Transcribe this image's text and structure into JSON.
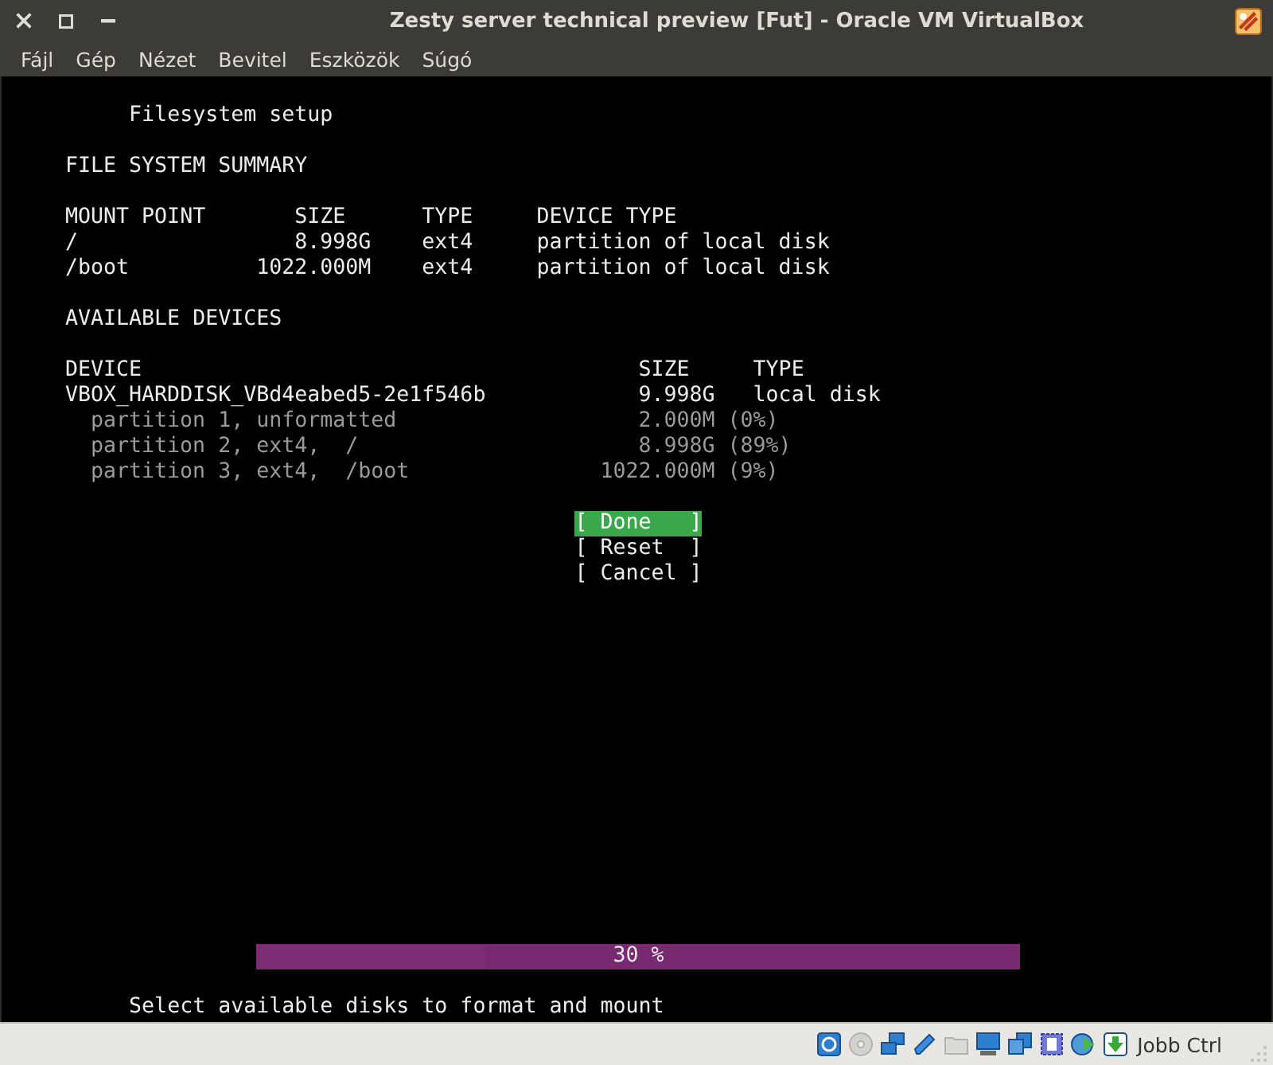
{
  "window": {
    "title": "Zesty server technical preview [Fut] - Oracle VM VirtualBox"
  },
  "menu": [
    "Fájl",
    "Gép",
    "Nézet",
    "Bevitel",
    "Eszközök",
    "Súgó"
  ],
  "screen": {
    "heading": "Filesystem setup",
    "summary": {
      "title": "FILE SYSTEM SUMMARY",
      "columns": [
        "MOUNT POINT",
        "SIZE",
        "TYPE",
        "DEVICE TYPE"
      ],
      "rows": [
        {
          "mount_point": "/",
          "size": "8.998G",
          "type": "ext4",
          "device_type": "partition of local disk"
        },
        {
          "mount_point": "/boot",
          "size": "1022.000M",
          "type": "ext4",
          "device_type": "partition of local disk"
        }
      ]
    },
    "devices": {
      "title": "AVAILABLE DEVICES",
      "columns": [
        "DEVICE",
        "SIZE",
        "TYPE"
      ],
      "rows": [
        {
          "kind": "disk",
          "device": "VBOX_HARDDISK_VBd4eabed5-2e1f546b",
          "size": "9.998G",
          "type": "local disk"
        },
        {
          "kind": "partition",
          "device": "partition 1, unformatted",
          "size": "2.000M",
          "share": "(0%)"
        },
        {
          "kind": "partition",
          "device": "partition 2, ext4,  /",
          "size": "8.998G",
          "share": "(89%)"
        },
        {
          "kind": "partition",
          "device": "partition 3, ext4,  /boot",
          "size": "1022.000M",
          "share": "(9%)"
        }
      ]
    },
    "buttons": [
      {
        "label": "[ Done   ]",
        "selected": true
      },
      {
        "label": "[ Reset  ]",
        "selected": false
      },
      {
        "label": "[ Cancel ]",
        "selected": false
      }
    ],
    "progress": {
      "label": "30 %",
      "level": 0.3
    },
    "hint": "Select available disks to format and mount"
  },
  "status_bar": {
    "host_key": "Jobb Ctrl"
  }
}
